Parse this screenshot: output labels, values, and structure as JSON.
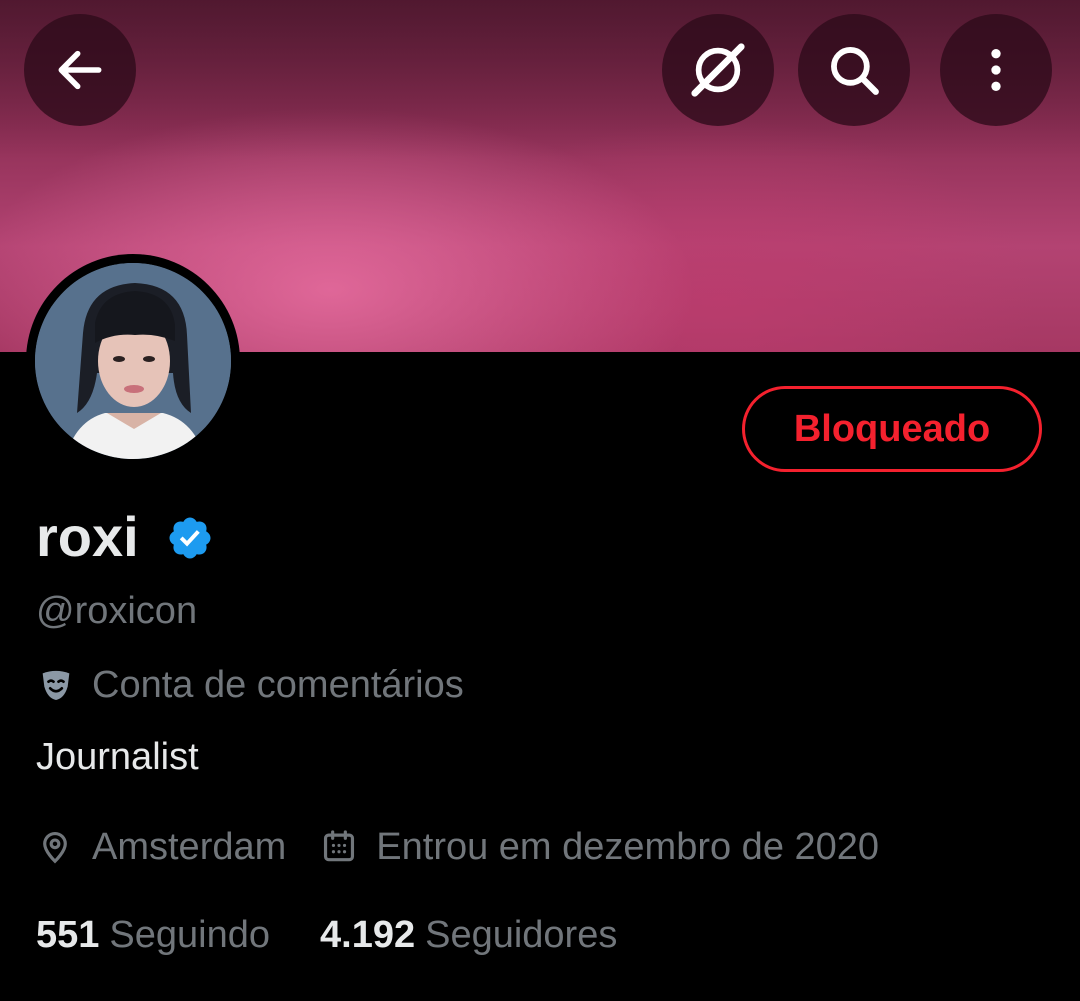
{
  "header": {
    "back_icon": "arrow-left-icon",
    "grok_icon": "grok-icon",
    "search_icon": "search-icon",
    "more_icon": "more-vertical-icon"
  },
  "profile": {
    "display_name": "roxi",
    "verified_icon": "verified-badge-icon",
    "handle": "@roxicon",
    "label": "Conta de comentários",
    "label_icon": "theater-mask-icon",
    "bio": "Journalist",
    "location": "Amsterdam",
    "location_icon": "location-pin-icon",
    "joined": "Entrou em dezembro de 2020",
    "joined_icon": "calendar-icon",
    "following_count": "551",
    "following_label": "Seguindo",
    "followers_count": "4.192",
    "followers_label": "Seguidores",
    "blocked_label": "Bloqueado"
  },
  "colors": {
    "blocked": "#f4212e",
    "verified": "#1d9bf0",
    "secondary_text": "#71767b",
    "primary_text": "#e7e9ea"
  }
}
